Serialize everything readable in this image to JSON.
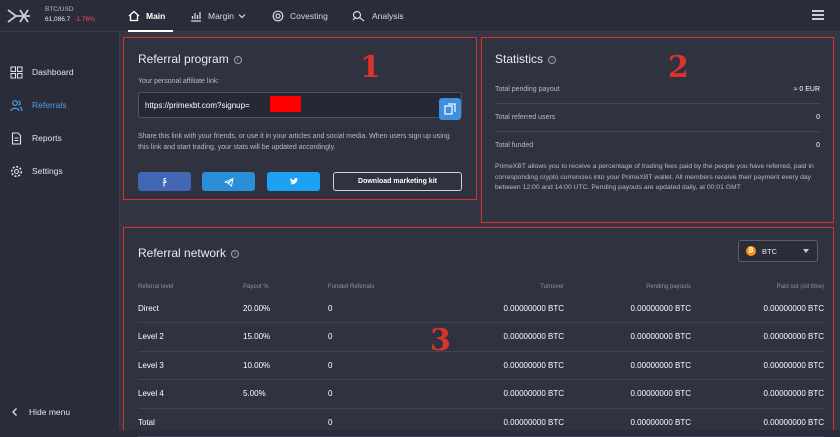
{
  "header": {
    "ticker": {
      "pair": "BTC/USD",
      "price": "61,086.7",
      "change": "-1.76%"
    },
    "nav": [
      {
        "label": "Main",
        "icon": "home-icon"
      },
      {
        "label": "Margin",
        "icon": "chart-icon"
      },
      {
        "label": "Covesting",
        "icon": "covesting-icon"
      },
      {
        "label": "Analysis",
        "icon": "analysis-icon"
      }
    ]
  },
  "sidebar": {
    "items": [
      {
        "label": "Dashboard",
        "icon": "dashboard-icon"
      },
      {
        "label": "Referrals",
        "icon": "users-icon"
      },
      {
        "label": "Reports",
        "icon": "document-icon"
      },
      {
        "label": "Settings",
        "icon": "gear-icon"
      }
    ],
    "hide_label": "Hide menu"
  },
  "referral": {
    "number": "1",
    "title": "Referral program",
    "link_label": "Your personal affiliate link:",
    "link": "https://primexbt.com?signup=",
    "share_text": "Share this link with your friends, or use it in your articles and social media. When users sign up using this link and start trading, your stats will be updated accordingly.",
    "download_label": "Download marketing kit"
  },
  "statistics": {
    "number": "2",
    "title": "Statistics",
    "rows": [
      {
        "label": "Total pending payout",
        "value": "≈ 0 EUR"
      },
      {
        "label": "Total referred users",
        "value": "0"
      },
      {
        "label": "Total funded",
        "value": "0"
      }
    ],
    "description": "PrimeXBT allows you to receive a percentage of trading fees paid by the people you have referred, paid in corresponding crypto currencies into your PrimeXBT wallet. All members receive their payment every day between 12:00 and 14:00 UTC. Pending payouts are updated daily, at 00:01 GMT"
  },
  "network": {
    "number": "3",
    "title": "Referral network",
    "currency": "BTC",
    "columns": [
      "Referral level",
      "Payout %",
      "Funded Referrals",
      "Turnover",
      "Pending payouts",
      "Paid out (All time)"
    ],
    "rows": [
      [
        "Direct",
        "20.00%",
        "0",
        "0.00000000 BTC",
        "0.00000000 BTC",
        "0.00000000 BTC"
      ],
      [
        "Level 2",
        "15.00%",
        "0",
        "0.00000000 BTC",
        "0.00000000 BTC",
        "0.00000000 BTC"
      ],
      [
        "Level 3",
        "10.00%",
        "0",
        "0.00000000 BTC",
        "0.00000000 BTC",
        "0.00000000 BTC"
      ],
      [
        "Level 4",
        "5.00%",
        "0",
        "0.00000000 BTC",
        "0.00000000 BTC",
        "0.00000000 BTC"
      ],
      [
        "Total",
        "",
        "0",
        "0.00000000 BTC",
        "0.00000000 BTC",
        "0.00000000 BTC"
      ]
    ]
  },
  "colors": {
    "accent": "#3e8fe0",
    "annotation": "#d9342b",
    "negative": "#ef5350",
    "redaction": "#ff0000"
  }
}
